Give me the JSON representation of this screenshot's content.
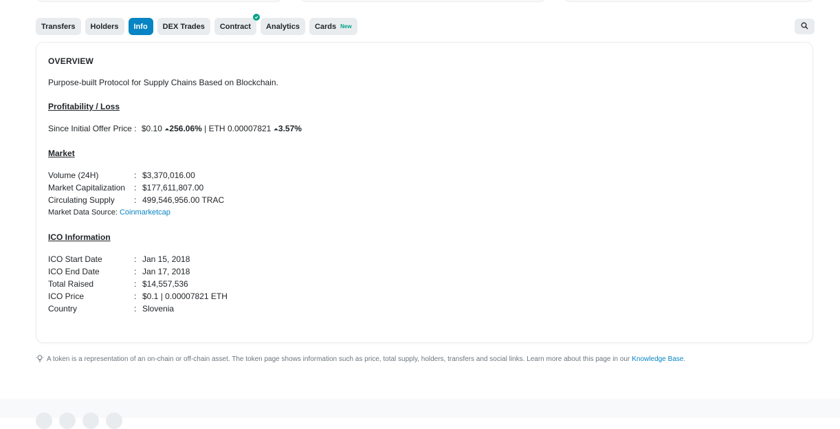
{
  "tabs": [
    {
      "label": "Transfers"
    },
    {
      "label": "Holders"
    },
    {
      "label": "Info"
    },
    {
      "label": "DEX Trades"
    },
    {
      "label": "Contract"
    },
    {
      "label": "Analytics"
    },
    {
      "label": "Cards",
      "badge": "New"
    }
  ],
  "overview": {
    "heading": "OVERVIEW",
    "description": "Purpose-built Protocol for Supply Chains Based on Blockchain."
  },
  "profitability": {
    "title": "Profitability / Loss",
    "label": "Since Initial Offer Price :",
    "usd_price": "$0.10",
    "usd_change": "256.06%",
    "separator": "| ETH",
    "eth_price": "0.00007821",
    "eth_change": "3.57%"
  },
  "market": {
    "title": "Market",
    "rows": [
      {
        "label": "Volume (24H)",
        "value": "$3,370,016.00"
      },
      {
        "label": "Market Capitalization",
        "value": "$177,611,807.00"
      },
      {
        "label": "Circulating Supply",
        "value": "499,546,956.00 TRAC"
      }
    ],
    "source_label": "Market Data Source:",
    "source_link": "Coinmarketcap"
  },
  "ico": {
    "title": "ICO Information",
    "rows": [
      {
        "label": "ICO Start Date",
        "value": "Jan 15, 2018"
      },
      {
        "label": "ICO End Date",
        "value": "Jan 17, 2018"
      },
      {
        "label": "Total Raised",
        "value": "$14,557,536"
      },
      {
        "label": "ICO Price",
        "value": "$0.1 | 0.00007821 ETH"
      },
      {
        "label": "Country",
        "value": "Slovenia"
      }
    ]
  },
  "footnote": {
    "text": "A token is a representation of an on-chain or off-chain asset. The token page shows information such as price, total supply, holders, transfers and social links. Learn more about this page in our",
    "link": "Knowledge Base",
    "end": "."
  },
  "colon": ":",
  "colors": {
    "accent": "#0784c3",
    "success": "#00a186",
    "tab_bg": "#e9ecef"
  },
  "icons": {
    "search": "search-icon",
    "verified": "check-circle-icon",
    "bulb": "lightbulb-icon",
    "arrow_up": "caret-up-icon"
  }
}
